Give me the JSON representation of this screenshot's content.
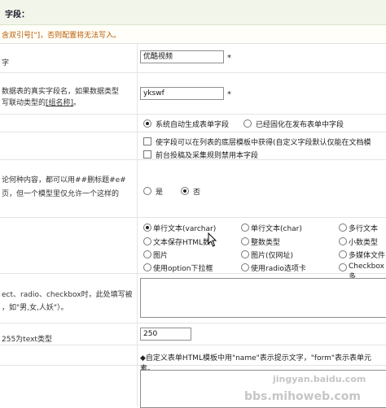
{
  "header": {
    "title": "字段："
  },
  "notice": {
    "text": "含双引号[\"]，否则配置将无法写入。"
  },
  "rows": {
    "display_name": {
      "label": "字",
      "value": "优酷视频"
    },
    "field_name": {
      "label_line1": "数据表的真实字段名，如果数据类型",
      "label_line2_prefix": "写联动类型的",
      "label_link": "[组名称]",
      "label_line2_suffix": "。",
      "value": "ykswf"
    },
    "required_star": "*",
    "field_mode": {
      "options": [
        "系统自动生成表单字段",
        "已经固化在发布表单中字段"
      ],
      "selected": 0
    },
    "field_checks": {
      "items": [
        "使字段可以在列表的底层模板中获得(自定义字段默认仅能在文档模",
        "前台投稿及采集规则禁用本字段"
      ]
    },
    "allow_html": {
      "label_line1": "论何种内容，都可以用##删标题#e#",
      "label_line2": "页，但一个模型里仅允许一个这样的",
      "yes": "是",
      "no": "否",
      "selected": "no"
    },
    "data_type": {
      "options": [
        [
          "单行文本(varchar)",
          "单行文本(char)",
          "多行文本"
        ],
        [
          "文本保存HTML数",
          "整数类型",
          "小数类型"
        ],
        [
          "图片",
          "图片(仅网址)",
          "多媒体文件"
        ],
        [
          "使用option下拉框",
          "使用radio选项卡",
          "Checkbox多"
        ]
      ],
      "selected": [
        0,
        0
      ]
    },
    "default_value": {
      "label_line1": "ect、radio、checkbox时，此处填写被",
      "label_line2": "，如\"男,女,人妖\"）。"
    },
    "max_length": {
      "label": "255为text类型",
      "value": "250"
    },
    "custom_html": {
      "note": "◆自定义表单HTML模板中用\"name\"表示提示文字，\"form\"表示表单元素。"
    }
  },
  "watermarks": {
    "line1": "jingyan.baidu.com",
    "line2": "bbs.mihoweb.com"
  },
  "colors": {
    "header_bg": "#f2f6ea",
    "notice_text": "#b85a00"
  }
}
